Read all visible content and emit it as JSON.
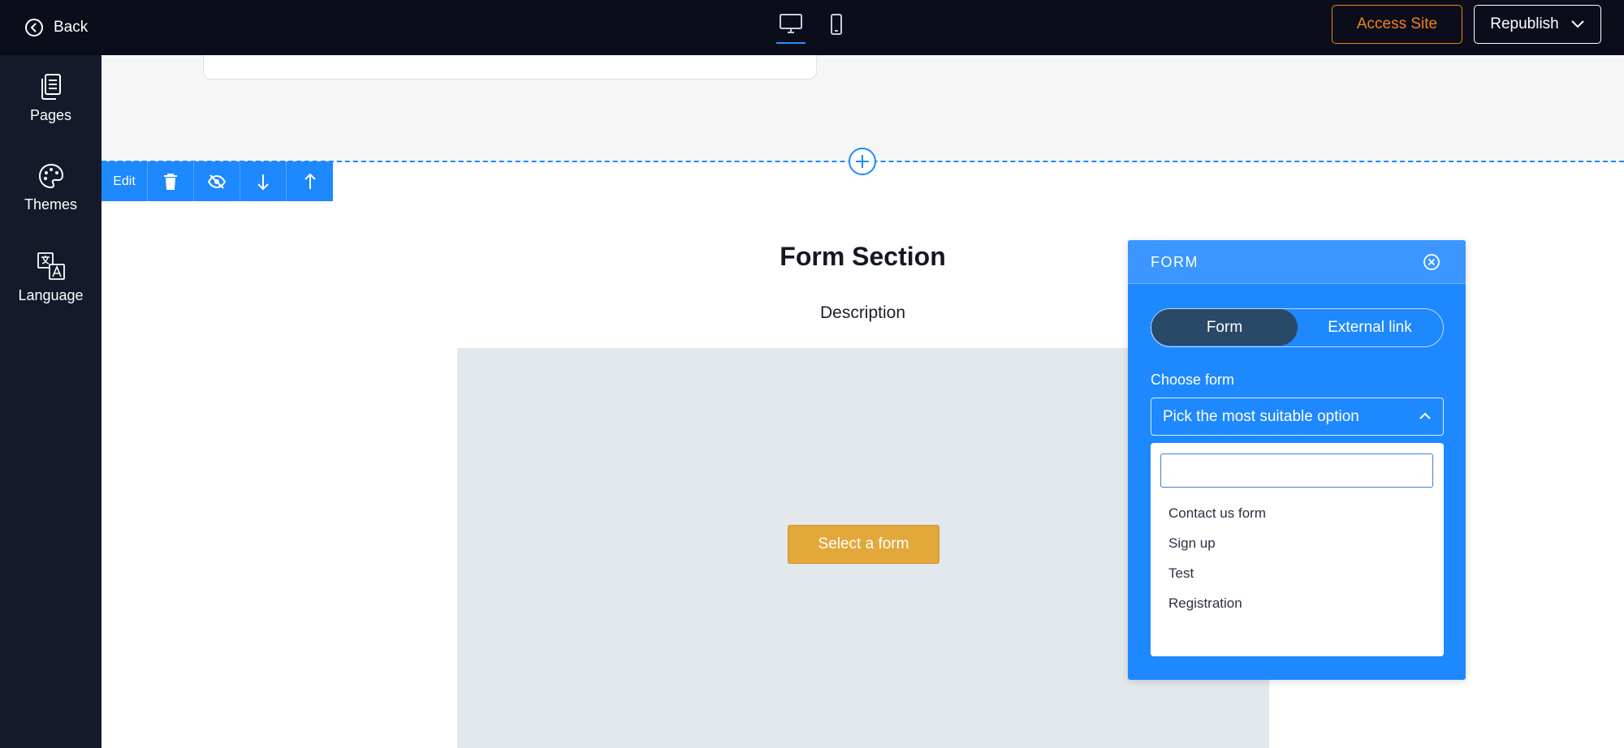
{
  "topbar": {
    "back_label": "Back",
    "access_site_label": "Access Site",
    "republish_label": "Republish",
    "devices": [
      {
        "name": "desktop",
        "icon": "desktop-icon",
        "active": true
      },
      {
        "name": "mobile",
        "icon": "mobile-icon",
        "active": false
      }
    ]
  },
  "sidebar": {
    "items": [
      {
        "label": "Pages",
        "icon": "pages-icon"
      },
      {
        "label": "Themes",
        "icon": "palette-icon"
      },
      {
        "label": "Language",
        "icon": "translate-icon"
      }
    ]
  },
  "section_toolbar": {
    "edit_label": "Edit",
    "tools": [
      "trash-icon",
      "eye-off-icon",
      "arrow-down-icon",
      "arrow-up-icon"
    ]
  },
  "form_section": {
    "title": "Form Section",
    "description": "Description",
    "select_form_label": "Select a form"
  },
  "form_panel": {
    "title": "FORM",
    "toggle": {
      "active": "Form",
      "inactive": "External link"
    },
    "choose_label": "Choose form",
    "select_placeholder": "Pick the most suitable option",
    "search_value": "",
    "options": [
      "Contact us form",
      "Sign up",
      "Test",
      "Registration"
    ]
  },
  "colors": {
    "topbar_bg": "#0b0e1a",
    "sidebar_bg": "#141a2a",
    "accent_blue": "#1e88ff",
    "access_orange": "#f0821e",
    "select_form_gold": "#e2a83a",
    "toggle_active": "#2a4868"
  }
}
